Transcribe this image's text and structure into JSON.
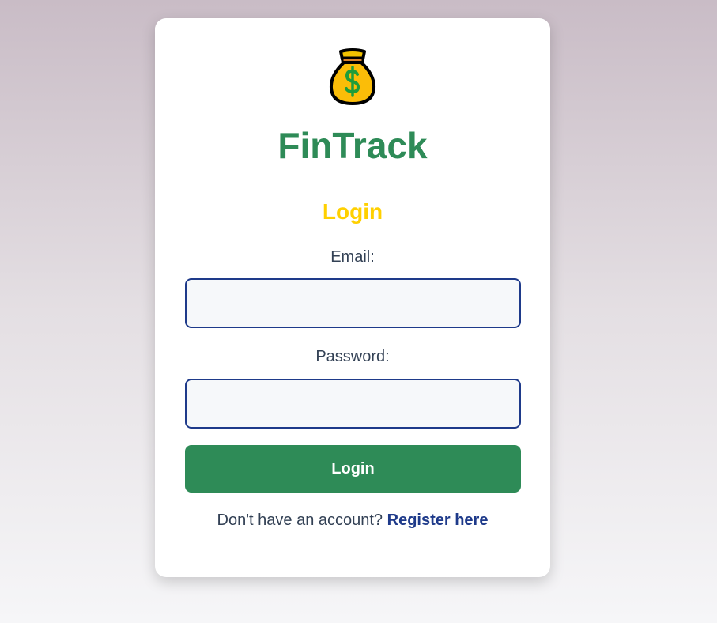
{
  "app": {
    "title": "FinTrack",
    "logo_icon": "money-bag-icon"
  },
  "form": {
    "heading": "Login",
    "email_label": "Email:",
    "email_value": "",
    "password_label": "Password:",
    "password_value": "",
    "submit_label": "Login"
  },
  "footer": {
    "prompt": "Don't have an account?",
    "register_link": "Register here"
  },
  "colors": {
    "brand_green": "#2e8b57",
    "heading_yellow": "#ffd000",
    "link_blue": "#1e3a8a",
    "input_border": "#1e3a8a"
  }
}
